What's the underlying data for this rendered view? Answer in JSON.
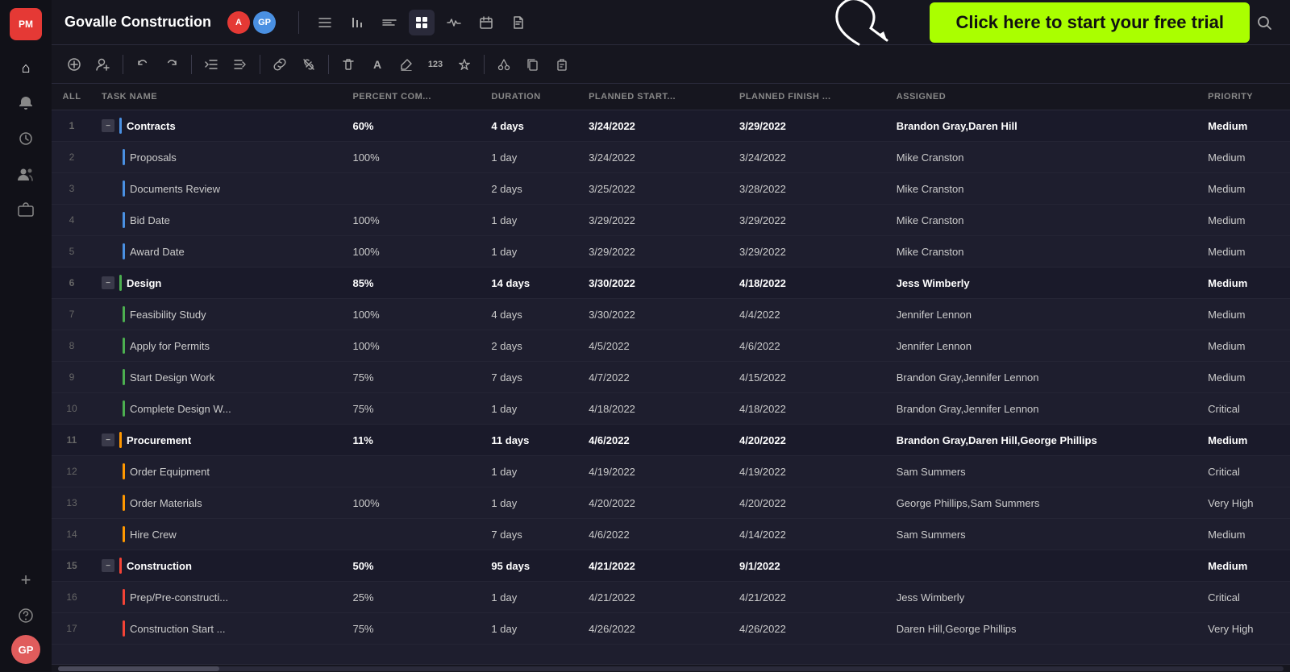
{
  "app": {
    "logo": "PM",
    "title": "Govalle Construction"
  },
  "cta": {
    "label": "Click here to start your free trial"
  },
  "topnav": {
    "avatars": [
      {
        "initials": "A",
        "color": "#e53935"
      },
      {
        "initials": "GP",
        "color": "#4a90e2"
      }
    ],
    "icons": [
      {
        "name": "list-icon",
        "symbol": "☰"
      },
      {
        "name": "bar-chart-icon",
        "symbol": "╎╎"
      },
      {
        "name": "lines-icon",
        "symbol": "≡"
      },
      {
        "name": "grid-icon",
        "symbol": "▦"
      },
      {
        "name": "pulse-icon",
        "symbol": "∿"
      },
      {
        "name": "calendar-icon",
        "symbol": "▦"
      },
      {
        "name": "file-icon",
        "symbol": "□"
      }
    ]
  },
  "toolbar": {
    "buttons": [
      {
        "name": "add-task-btn",
        "symbol": "⊕"
      },
      {
        "name": "add-user-btn",
        "symbol": "👤"
      },
      {
        "name": "undo-btn",
        "symbol": "↩"
      },
      {
        "name": "redo-btn",
        "symbol": "↪"
      },
      {
        "name": "outdent-btn",
        "symbol": "⇤"
      },
      {
        "name": "indent-btn",
        "symbol": "⇥"
      },
      {
        "name": "link-btn",
        "symbol": "🔗"
      },
      {
        "name": "unlink-btn",
        "symbol": "✂"
      },
      {
        "name": "delete-btn",
        "symbol": "🗑"
      },
      {
        "name": "font-btn",
        "symbol": "A"
      },
      {
        "name": "highlight-btn",
        "symbol": "✏"
      },
      {
        "name": "number-btn",
        "symbol": "123"
      },
      {
        "name": "shape-btn",
        "symbol": "◇"
      },
      {
        "name": "cut-btn",
        "symbol": "✂"
      },
      {
        "name": "copy-btn",
        "symbol": "⧉"
      },
      {
        "name": "paste-btn",
        "symbol": "📋"
      }
    ]
  },
  "table": {
    "columns": [
      "ALL",
      "TASK NAME",
      "PERCENT COM...",
      "DURATION",
      "PLANNED START...",
      "PLANNED FINISH ...",
      "ASSIGNED",
      "PRIORITY"
    ],
    "rows": [
      {
        "num": "1",
        "isGroup": true,
        "colorBar": "blue",
        "name": "Contracts",
        "percent": "60%",
        "duration": "4 days",
        "start": "3/24/2022",
        "finish": "3/29/2022",
        "assigned": "Brandon Gray,Daren Hill",
        "priority": "Medium"
      },
      {
        "num": "2",
        "isGroup": false,
        "colorBar": "blue",
        "name": "Proposals",
        "percent": "100%",
        "duration": "1 day",
        "start": "3/24/2022",
        "finish": "3/24/2022",
        "assigned": "Mike Cranston",
        "priority": "Medium"
      },
      {
        "num": "3",
        "isGroup": false,
        "colorBar": "blue",
        "name": "Documents Review",
        "percent": "",
        "duration": "2 days",
        "start": "3/25/2022",
        "finish": "3/28/2022",
        "assigned": "Mike Cranston",
        "priority": "Medium"
      },
      {
        "num": "4",
        "isGroup": false,
        "colorBar": "blue",
        "name": "Bid Date",
        "percent": "100%",
        "duration": "1 day",
        "start": "3/29/2022",
        "finish": "3/29/2022",
        "assigned": "Mike Cranston",
        "priority": "Medium"
      },
      {
        "num": "5",
        "isGroup": false,
        "colorBar": "blue",
        "name": "Award Date",
        "percent": "100%",
        "duration": "1 day",
        "start": "3/29/2022",
        "finish": "3/29/2022",
        "assigned": "Mike Cranston",
        "priority": "Medium"
      },
      {
        "num": "6",
        "isGroup": true,
        "colorBar": "green",
        "name": "Design",
        "percent": "85%",
        "duration": "14 days",
        "start": "3/30/2022",
        "finish": "4/18/2022",
        "assigned": "Jess Wimberly",
        "priority": "Medium"
      },
      {
        "num": "7",
        "isGroup": false,
        "colorBar": "green",
        "name": "Feasibility Study",
        "percent": "100%",
        "duration": "4 days",
        "start": "3/30/2022",
        "finish": "4/4/2022",
        "assigned": "Jennifer Lennon",
        "priority": "Medium"
      },
      {
        "num": "8",
        "isGroup": false,
        "colorBar": "green",
        "name": "Apply for Permits",
        "percent": "100%",
        "duration": "2 days",
        "start": "4/5/2022",
        "finish": "4/6/2022",
        "assigned": "Jennifer Lennon",
        "priority": "Medium"
      },
      {
        "num": "9",
        "isGroup": false,
        "colorBar": "green",
        "name": "Start Design Work",
        "percent": "75%",
        "duration": "7 days",
        "start": "4/7/2022",
        "finish": "4/15/2022",
        "assigned": "Brandon Gray,Jennifer Lennon",
        "priority": "Medium"
      },
      {
        "num": "10",
        "isGroup": false,
        "colorBar": "green",
        "name": "Complete Design W...",
        "percent": "75%",
        "duration": "1 day",
        "start": "4/18/2022",
        "finish": "4/18/2022",
        "assigned": "Brandon Gray,Jennifer Lennon",
        "priority": "Critical"
      },
      {
        "num": "11",
        "isGroup": true,
        "colorBar": "orange",
        "name": "Procurement",
        "percent": "11%",
        "duration": "11 days",
        "start": "4/6/2022",
        "finish": "4/20/2022",
        "assigned": "Brandon Gray,Daren Hill,George Phillips",
        "priority": "Medium"
      },
      {
        "num": "12",
        "isGroup": false,
        "colorBar": "orange",
        "name": "Order Equipment",
        "percent": "",
        "duration": "1 day",
        "start": "4/19/2022",
        "finish": "4/19/2022",
        "assigned": "Sam Summers",
        "priority": "Critical"
      },
      {
        "num": "13",
        "isGroup": false,
        "colorBar": "orange",
        "name": "Order Materials",
        "percent": "100%",
        "duration": "1 day",
        "start": "4/20/2022",
        "finish": "4/20/2022",
        "assigned": "George Phillips,Sam Summers",
        "priority": "Very High"
      },
      {
        "num": "14",
        "isGroup": false,
        "colorBar": "orange",
        "name": "Hire Crew",
        "percent": "",
        "duration": "7 days",
        "start": "4/6/2022",
        "finish": "4/14/2022",
        "assigned": "Sam Summers",
        "priority": "Medium"
      },
      {
        "num": "15",
        "isGroup": true,
        "colorBar": "red",
        "name": "Construction",
        "percent": "50%",
        "duration": "95 days",
        "start": "4/21/2022",
        "finish": "9/1/2022",
        "assigned": "",
        "priority": "Medium"
      },
      {
        "num": "16",
        "isGroup": false,
        "colorBar": "red",
        "name": "Prep/Pre-constructi...",
        "percent": "25%",
        "duration": "1 day",
        "start": "4/21/2022",
        "finish": "4/21/2022",
        "assigned": "Jess Wimberly",
        "priority": "Critical"
      },
      {
        "num": "17",
        "isGroup": false,
        "colorBar": "red",
        "name": "Construction Start ...",
        "percent": "75%",
        "duration": "1 day",
        "start": "4/26/2022",
        "finish": "4/26/2022",
        "assigned": "Daren Hill,George Phillips",
        "priority": "Very High"
      }
    ]
  },
  "sidebar": {
    "items": [
      {
        "name": "home-icon",
        "symbol": "⌂"
      },
      {
        "name": "notifications-icon",
        "symbol": "🔔"
      },
      {
        "name": "recent-icon",
        "symbol": "🕐"
      },
      {
        "name": "team-icon",
        "symbol": "👥"
      },
      {
        "name": "portfolio-icon",
        "symbol": "💼"
      },
      {
        "name": "add-icon",
        "symbol": "+"
      },
      {
        "name": "help-icon",
        "symbol": "?"
      }
    ]
  }
}
